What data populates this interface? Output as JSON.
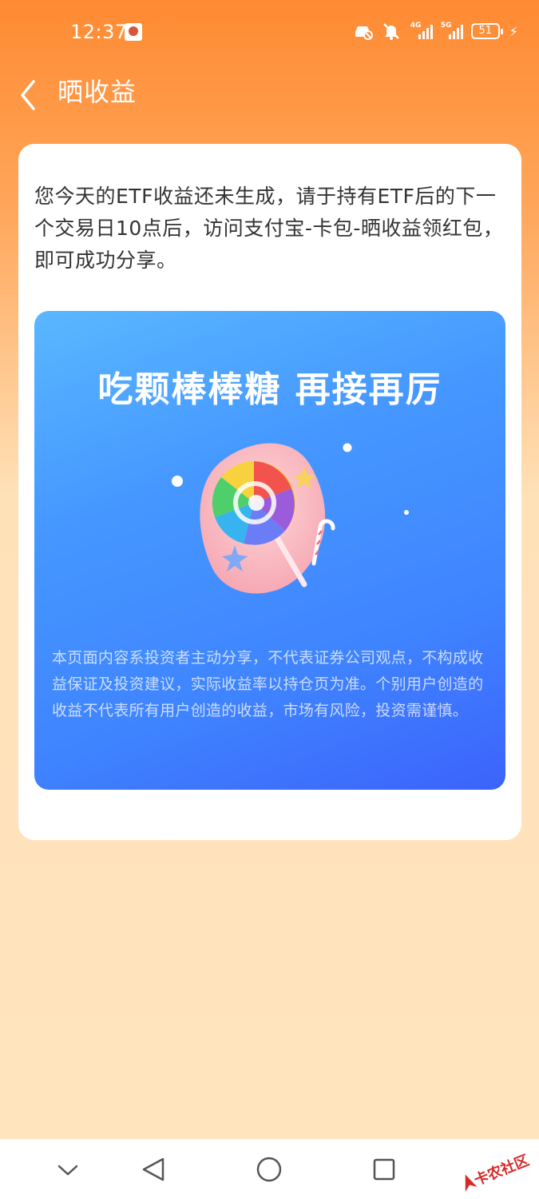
{
  "status_bar": {
    "time": "12:37",
    "network_1": "4G",
    "network_2": "5G",
    "battery": "51"
  },
  "header": {
    "title": "晒收益"
  },
  "card": {
    "message": "您今天的ETF收益还未生成，请于持有ETF后的下一个交易日10点后，访问支付宝-卡包-晒收益领红包，即可成功分享。",
    "promo_title": "吃颗棒棒糖 再接再厉",
    "disclaimer": "本页面内容系投资者主动分享，不代表证券公司观点，不构成收益保证及投资建议，实际收益率以持仓页为准。个别用户创造的收益不代表所有用户创造的收益，市场有风险，投资需谨慎。"
  },
  "watermark": {
    "text": "卡农社区"
  },
  "colors": {
    "header_orange": "#ff8a32",
    "page_bg": "#ffe4be",
    "promo_blue": "#4597ff"
  }
}
